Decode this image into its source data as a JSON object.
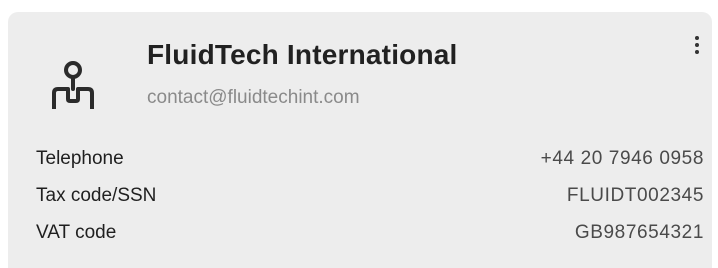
{
  "company": {
    "name": "FluidTech International",
    "email": "contact@fluidtechint.com",
    "avatar_icon": "person-icon",
    "menu_icon": "more-vertical-icon"
  },
  "details": [
    {
      "label": "Telephone",
      "value": "+44 20 7946 0958"
    },
    {
      "label": "Tax code/SSN",
      "value": "FLUIDT002345"
    },
    {
      "label": "VAT code",
      "value": "GB987654321"
    }
  ],
  "colors": {
    "card_background": "#ededed",
    "text_primary": "#212121",
    "text_secondary": "#8a8a8a"
  }
}
